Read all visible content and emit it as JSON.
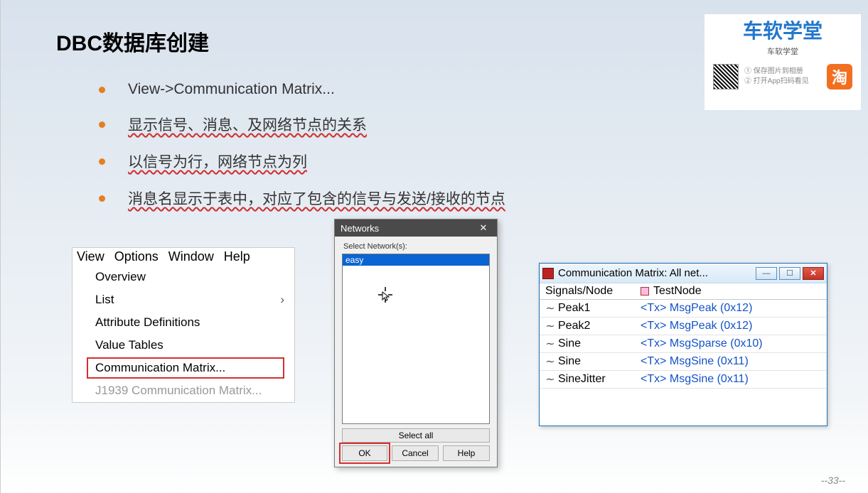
{
  "title": "DBC数据库创建",
  "bullets": [
    {
      "text": "View->Communication Matrix...",
      "wavy": false
    },
    {
      "text": "显示信号、消息、及网络节点的关系",
      "wavy": true
    },
    {
      "text": "以信号为行，网络节点为列",
      "wavy": true
    },
    {
      "text": "消息名显示于表中，对应了包含的信号与发送/接收的节点",
      "wavy": true
    }
  ],
  "viewMenu": {
    "bar": [
      "View",
      "Options",
      "Window",
      "Help"
    ],
    "items": [
      {
        "label": "Overview"
      },
      {
        "label": "List",
        "sub": true
      },
      {
        "label": "Attribute Definitions"
      },
      {
        "label": "Value Tables"
      },
      {
        "label": "Communication Matrix...",
        "highlight": true
      },
      {
        "label": "J1939 Communication Matrix...",
        "disabled": true
      }
    ]
  },
  "netDialog": {
    "title": "Networks",
    "selectLbl": "Select Network(s):",
    "entry": "easy",
    "selectAll": "Select all",
    "ok": "OK",
    "cancel": "Cancel",
    "help": "Help"
  },
  "matrix": {
    "title": "Communication Matrix: All net...",
    "col1": "Signals/Node",
    "col2": "TestNode",
    "rows": [
      {
        "sig": "Peak1",
        "msg": "<Tx> MsgPeak (0x12)"
      },
      {
        "sig": "Peak2",
        "msg": "<Tx> MsgPeak (0x12)"
      },
      {
        "sig": "Sine",
        "msg": "<Tx> MsgSparse (0x10)"
      },
      {
        "sig": "Sine",
        "msg": "<Tx> MsgSine (0x11)"
      },
      {
        "sig": "SineJitter",
        "msg": "<Tx> MsgSine (0x11)"
      }
    ]
  },
  "watermark": {
    "title": "车软学堂",
    "sub": "车软学堂",
    "step1": "① 保存图片到相册",
    "step2": "② 打开App扫码看见",
    "tao": "淘"
  },
  "page": "--33--"
}
